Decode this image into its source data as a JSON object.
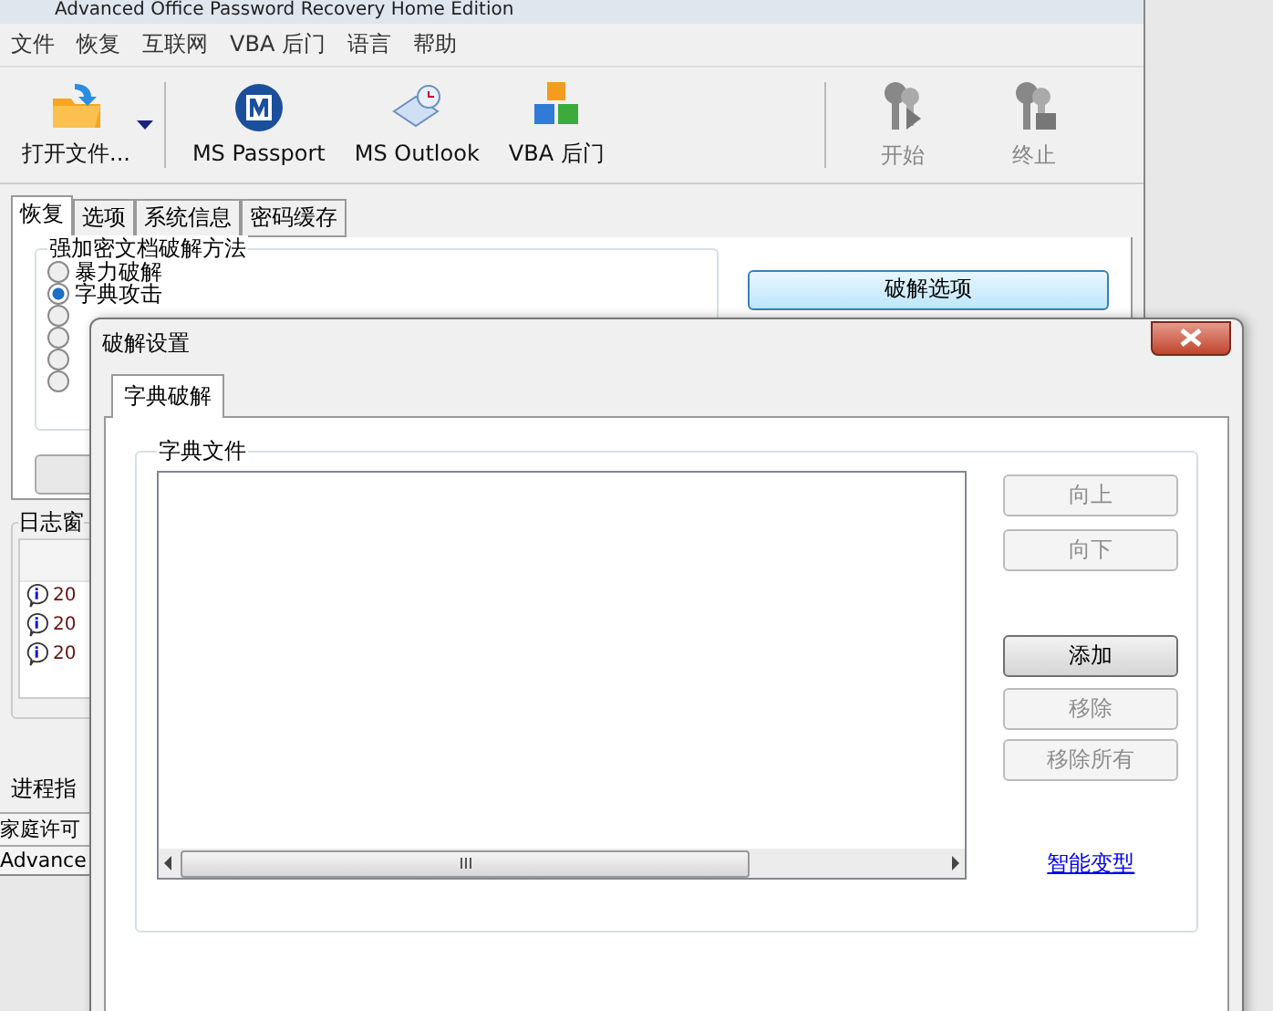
{
  "main_window": {
    "title": "Advanced Office Password Recovery Home Edition",
    "menu": [
      "文件",
      "恢复",
      "互联网",
      "VBA 后门",
      "语言",
      "帮助"
    ],
    "toolbar": [
      {
        "label": "打开文件...",
        "has_menu": true,
        "disabled": false
      },
      {
        "label": "MS Passport",
        "has_menu": false,
        "disabled": false
      },
      {
        "label": "MS Outlook",
        "has_menu": false,
        "disabled": false
      },
      {
        "label": "VBA 后门",
        "has_menu": false,
        "disabled": false
      },
      {
        "label": "开始",
        "has_menu": false,
        "disabled": true
      },
      {
        "label": "终止",
        "has_menu": false,
        "disabled": true
      }
    ],
    "tabs": [
      {
        "label": "恢复",
        "selected": true
      },
      {
        "label": "选项",
        "selected": false
      },
      {
        "label": "系统信息",
        "selected": false
      },
      {
        "label": "密码缓存",
        "selected": false
      }
    ],
    "method_group": {
      "title": "强加密文档破解方法",
      "options": [
        {
          "label": "暴力破解",
          "selected": false
        },
        {
          "label": "字典攻击",
          "selected": true
        },
        {
          "selected": false
        },
        {
          "selected": false
        },
        {
          "selected": false
        },
        {
          "selected": false
        }
      ]
    },
    "options_button": "破解选项",
    "log": {
      "title": "日志窗",
      "rows": [
        "20",
        "20",
        "20"
      ]
    },
    "progress_label": "进程指",
    "status_lines": [
      "家庭许可",
      "Advance"
    ]
  },
  "dialog": {
    "title": "破解设置",
    "tabs": [
      {
        "label": "字典破解",
        "selected": true
      }
    ],
    "group_title": "字典文件",
    "buttons": [
      {
        "label": "向上",
        "disabled": true
      },
      {
        "label": "向下",
        "disabled": true
      },
      {
        "label": "添加",
        "disabled": false
      },
      {
        "label": "移除",
        "disabled": true
      },
      {
        "label": "移除所有",
        "disabled": true
      }
    ],
    "link": "智能变型"
  }
}
